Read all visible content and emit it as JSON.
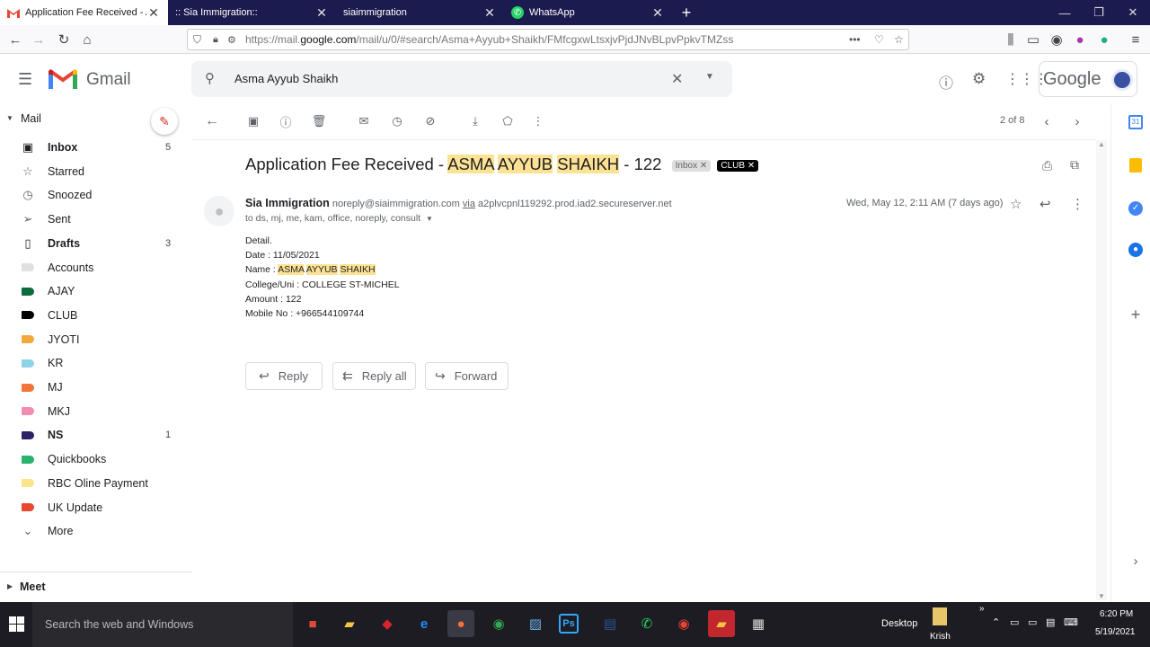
{
  "browser": {
    "tabs": [
      {
        "title": "Application Fee Received - ASMA AYYUB SHAIKH",
        "icon": "gmail-icon",
        "active": true
      },
      {
        "title": ":: Sia Immigration::",
        "icon": "none",
        "active": false
      },
      {
        "title": "siaimmigration",
        "icon": "none",
        "active": false
      },
      {
        "title": "WhatsApp",
        "icon": "whatsapp-icon",
        "active": false
      }
    ],
    "url_prefix": "https://mail.",
    "url_domain": "google.com",
    "url_path": "/mail/u/0/#search/Asma+Ayyub+Shaikh/FMfcgxwLtsxjvPjdJNvBLpvPpkvTMZss"
  },
  "gmail": {
    "logo_text": "Gmail",
    "search_query": "Asma Ayyub Shaikh",
    "google_text": "Google",
    "sidebar": {
      "mail_label": "Mail",
      "items": [
        {
          "label": "Inbox",
          "count": "5",
          "bold": true,
          "icon": "inbox-icon"
        },
        {
          "label": "Starred",
          "count": "",
          "bold": false,
          "icon": "star-icon"
        },
        {
          "label": "Snoozed",
          "count": "",
          "bold": false,
          "icon": "clock-icon"
        },
        {
          "label": "Sent",
          "count": "",
          "bold": false,
          "icon": "send-icon"
        },
        {
          "label": "Drafts",
          "count": "3",
          "bold": true,
          "icon": "draft-icon"
        },
        {
          "label": "Accounts",
          "count": "",
          "bold": false,
          "icon": "label-icon",
          "color": "#e0e0e0"
        },
        {
          "label": "AJAY",
          "count": "",
          "bold": false,
          "icon": "label-icon",
          "color": "#0b6b3a"
        },
        {
          "label": "CLUB",
          "count": "",
          "bold": false,
          "icon": "label-icon",
          "color": "#000000"
        },
        {
          "label": "JYOTI",
          "count": "",
          "bold": false,
          "icon": "label-icon",
          "color": "#f2a93b"
        },
        {
          "label": "KR",
          "count": "",
          "bold": false,
          "icon": "label-icon",
          "color": "#8fd3e8"
        },
        {
          "label": "MJ",
          "count": "",
          "bold": false,
          "icon": "label-icon",
          "color": "#f2743b"
        },
        {
          "label": "MKJ",
          "count": "",
          "bold": false,
          "icon": "label-icon",
          "color": "#f28cb1"
        },
        {
          "label": "NS",
          "count": "1",
          "bold": true,
          "icon": "label-icon",
          "color": "#2b2268"
        },
        {
          "label": "Quickbooks",
          "count": "",
          "bold": false,
          "icon": "label-icon",
          "color": "#2ab26f"
        },
        {
          "label": "RBC Oline Payment",
          "count": "",
          "bold": false,
          "icon": "label-icon",
          "color": "#fbe58a"
        },
        {
          "label": "UK Update",
          "count": "",
          "bold": false,
          "icon": "label-icon",
          "color": "#e8492f"
        },
        {
          "label": "More",
          "count": "",
          "bold": false,
          "icon": "chevron-down-icon"
        }
      ],
      "meet_label": "Meet"
    },
    "pager": "2 of 8",
    "email": {
      "subject_pre": "Application Fee Received - ",
      "subject_h1": "ASMA",
      "subject_h2": "AYYUB",
      "subject_h3": "SHAIKH",
      "subject_post": " - 122",
      "chip_inbox": "Inbox",
      "chip_club": "CLUB",
      "sender_name": "Sia Immigration",
      "sender_email": "noreply@siaimmigration.com",
      "via_label": "via",
      "via_host": "a2plvcpnl119292.prod.iad2.secureserver.net",
      "recipients": "to ds, mj, me, kam, office, noreply, consult",
      "date": "Wed, May 12, 2:11 AM (7 days ago)",
      "body": {
        "detail": "Detail.",
        "date_line": "Date : 11/05/2021",
        "name_pre": "Name : ",
        "name_h1": "ASMA",
        "name_h2": "AYYUB",
        "name_h3": "SHAIKH",
        "college": "College/Uni : COLLEGE ST-MICHEL",
        "amount": "Amount : 122",
        "mobile": "Mobile No : +966544109744"
      },
      "buttons": {
        "reply": "Reply",
        "reply_all": "Reply all",
        "forward": "Forward"
      }
    }
  },
  "taskbar": {
    "search_placeholder": "Search the web and Windows",
    "desktop_label": "Desktop",
    "user_label": "Krish",
    "time": "6:20 PM",
    "date": "5/19/2021"
  }
}
